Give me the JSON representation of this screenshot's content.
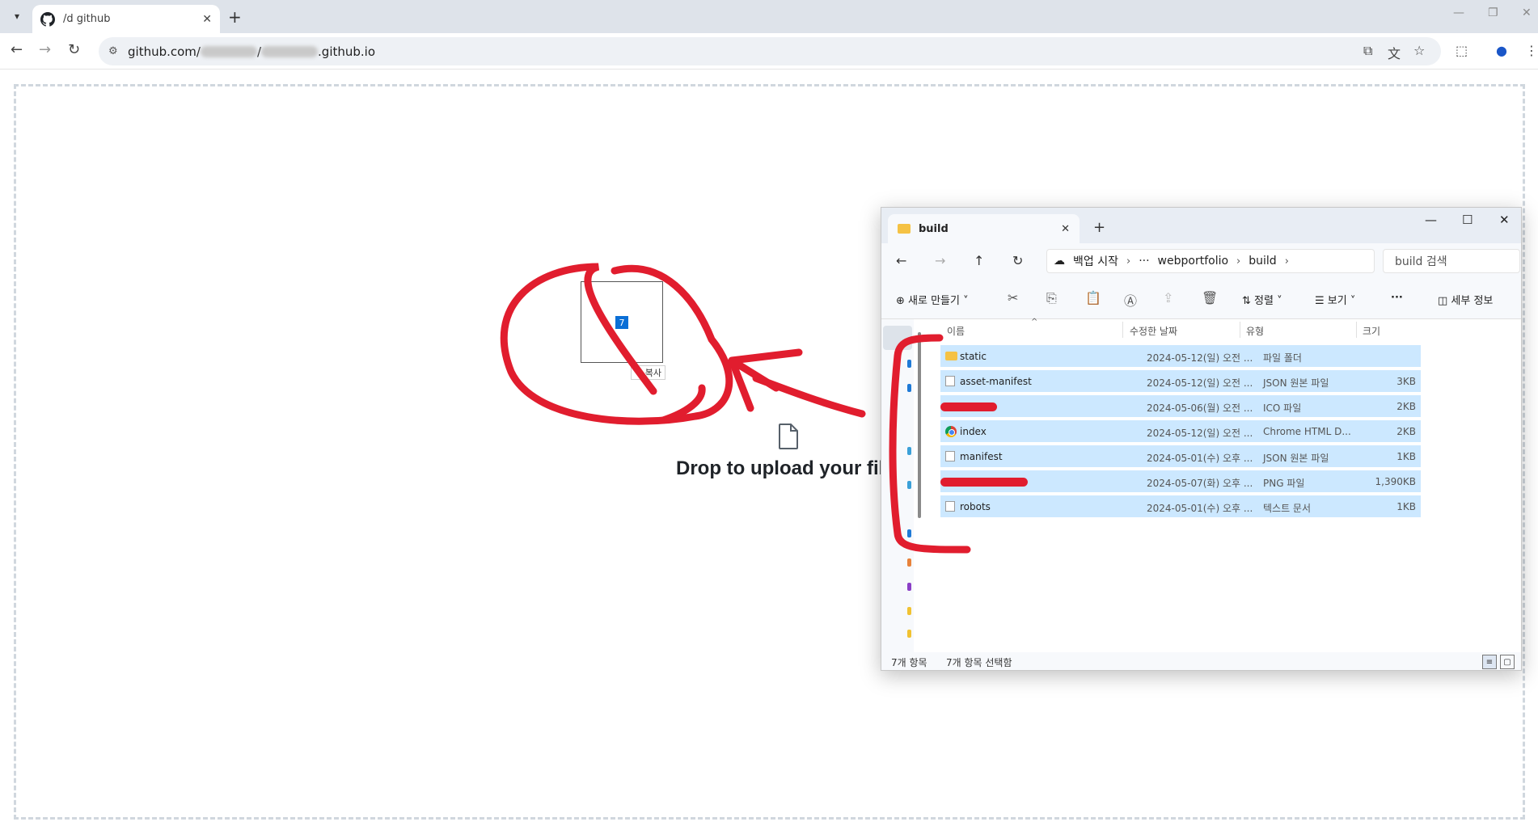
{
  "browser": {
    "tab_title": "/d       github",
    "url_prefix": "github.com/",
    "url_suffix": ".github.io"
  },
  "page": {
    "drop_text": "Drop to upload your fil",
    "drag_badge": "7",
    "copy_label": "+ 복사"
  },
  "explorer": {
    "tab_title": "build",
    "path": {
      "root": "백업 시작",
      "ellipsis": "···",
      "segments": [
        "webportfolio",
        "build"
      ]
    },
    "search_placeholder": "build 검색",
    "commands": {
      "new": "새로 만들기",
      "sort": "정렬",
      "view": "보기",
      "more": "···",
      "details": "세부 정보"
    },
    "columns": {
      "name": "이름",
      "date": "수정한 날짜",
      "type": "유형",
      "size": "크기"
    },
    "files": [
      {
        "name": "static",
        "date": "2024-05-12(일) 오전 ...",
        "type": "파일 폴더",
        "size": "",
        "icon": "folder-icon"
      },
      {
        "name": "asset-manifest",
        "date": "2024-05-12(일) 오전 ...",
        "type": "JSON 원본 파일",
        "size": "3KB",
        "icon": "file-icon"
      },
      {
        "name": "",
        "date": "2024-05-06(월) 오전 ...",
        "type": "ICO 파일",
        "size": "2KB",
        "icon": "none"
      },
      {
        "name": "index",
        "date": "2024-05-12(일) 오전 ...",
        "type": "Chrome HTML D...",
        "size": "2KB",
        "icon": "chrome-icon"
      },
      {
        "name": "manifest",
        "date": "2024-05-01(수) 오후 ...",
        "type": "JSON 원본 파일",
        "size": "1KB",
        "icon": "file-icon"
      },
      {
        "name": "",
        "date": "2024-05-07(화) 오후 ...",
        "type": "PNG 파일",
        "size": "1,390KB",
        "icon": "none"
      },
      {
        "name": "robots",
        "date": "2024-05-01(수) 오후 ...",
        "type": "텍스트 문서",
        "size": "1KB",
        "icon": "file-icon"
      }
    ],
    "status": {
      "count": "7개 항목",
      "selected": "7개 항목 선택함"
    }
  },
  "colors": {
    "annotation": "#e11d2e",
    "selection": "#cce8ff",
    "dropzone_border": "#d0d7de"
  }
}
